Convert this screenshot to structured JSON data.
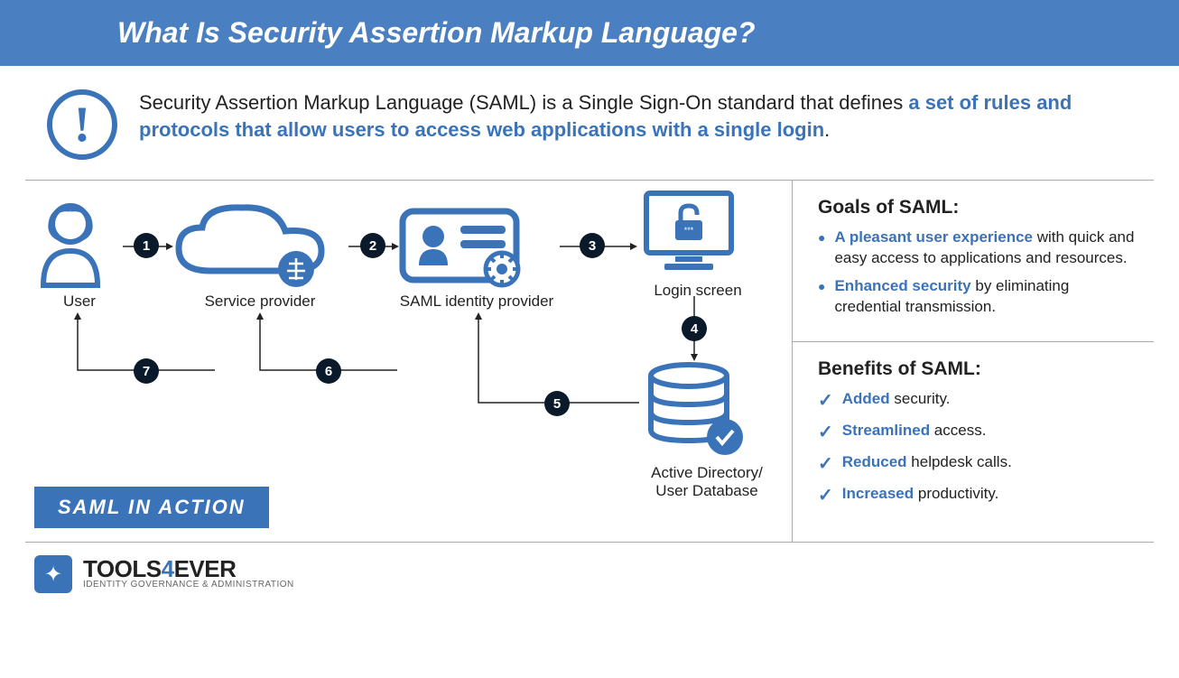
{
  "title": "What Is Security Assertion Markup Language?",
  "definition": {
    "pre": "Security Assertion Markup Language (SAML) is a Single Sign-On standard that defines ",
    "highlight": "a set of rules and protocols that allow users to access web applications with a single login",
    "post": "."
  },
  "diagram": {
    "action_label": "SAML IN ACTION",
    "nodes": {
      "user": "User",
      "sp": "Service provider",
      "idp": "SAML identity provider",
      "login": "Login screen",
      "db": "Active Directory/\nUser Database"
    },
    "steps": [
      "1",
      "2",
      "3",
      "4",
      "5",
      "6",
      "7"
    ]
  },
  "goals": {
    "title": "Goals of SAML:",
    "items": [
      {
        "hl": "A pleasant user experience",
        "rest": " with quick and easy access to applications and resources."
      },
      {
        "hl": "Enhanced security",
        "rest": " by eliminating credential transmission."
      }
    ]
  },
  "benefits": {
    "title": "Benefits of SAML:",
    "items": [
      {
        "hl": "Added",
        "rest": " security."
      },
      {
        "hl": "Streamlined",
        "rest": " access."
      },
      {
        "hl": "Reduced",
        "rest": " helpdesk calls."
      },
      {
        "hl": "Increased",
        "rest": " productivity."
      }
    ]
  },
  "footer": {
    "brand_pre": "TOOLS",
    "brand_mid": "4",
    "brand_post": "EVER",
    "tagline": "IDENTITY GOVERNANCE & ADMINISTRATION"
  }
}
